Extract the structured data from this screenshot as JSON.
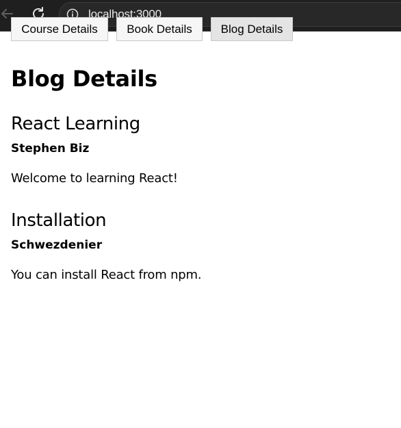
{
  "browser": {
    "url": "localhost:3000",
    "icons": {
      "back": "arrow-left-icon",
      "reload": "reload-icon",
      "site_info": "info-circle-icon"
    },
    "chrome_color": "#1f1f1f",
    "text_color": "#e8e8e8"
  },
  "nav_buttons": [
    {
      "label": "Course Details",
      "active": false
    },
    {
      "label": "Book Details",
      "active": false
    },
    {
      "label": "Blog Details",
      "active": true
    }
  ],
  "page": {
    "title": "Blog Details"
  },
  "blogs": [
    {
      "title": "React Learning",
      "author": "Stephen Biz",
      "content": "Welcome to learning React!"
    },
    {
      "title": "Installation",
      "author": "Schwezdenier",
      "content": "You can install React from npm."
    }
  ]
}
